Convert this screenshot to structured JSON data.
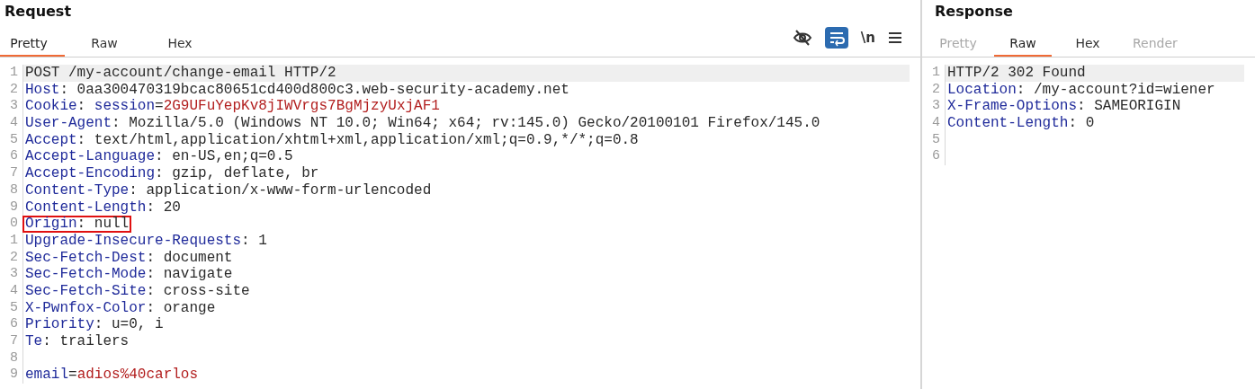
{
  "request": {
    "title": "Request",
    "tabs": [
      {
        "label": "Pretty",
        "selected": true,
        "disabled": false
      },
      {
        "label": "Raw",
        "selected": false,
        "disabled": false
      },
      {
        "label": "Hex",
        "selected": false,
        "disabled": false
      }
    ],
    "toolbar": [
      {
        "kind": "hide",
        "on": false
      },
      {
        "kind": "wrap",
        "on": true
      },
      {
        "kind": "newline",
        "label": "\\n",
        "on": false
      },
      {
        "kind": "menu"
      }
    ],
    "lines": [
      {
        "number": "1",
        "selected": true,
        "boxed": false,
        "parts": [
          {
            "kind": "plain",
            "text": "POST /my-account/change-email HTTP/2"
          }
        ]
      },
      {
        "number": "2",
        "selected": false,
        "boxed": false,
        "parts": [
          {
            "kind": "key",
            "text": "Host"
          },
          {
            "kind": "plain",
            "text": ": 0aa300470319bcac80651cd400d800c3.web-security-academy.net"
          }
        ]
      },
      {
        "number": "3",
        "selected": false,
        "boxed": false,
        "parts": [
          {
            "kind": "key",
            "text": "Cookie"
          },
          {
            "kind": "plain",
            "text": ": "
          },
          {
            "kind": "param",
            "text": "session"
          },
          {
            "kind": "plain",
            "text": "="
          },
          {
            "kind": "value",
            "text": "2G9UFuYepKv8jIWVrgs7BgMjzyUxjAF1"
          }
        ]
      },
      {
        "number": "4",
        "selected": false,
        "boxed": false,
        "parts": [
          {
            "kind": "key",
            "text": "User-Agent"
          },
          {
            "kind": "plain",
            "text": ": Mozilla/5.0 (Windows NT 10.0; Win64; x64; rv:145.0) Gecko/20100101 Firefox/145.0"
          }
        ]
      },
      {
        "number": "5",
        "selected": false,
        "boxed": false,
        "parts": [
          {
            "kind": "key",
            "text": "Accept"
          },
          {
            "kind": "plain",
            "text": ": text/html,application/xhtml+xml,application/xml;q=0.9,*/*;q=0.8"
          }
        ]
      },
      {
        "number": "6",
        "selected": false,
        "boxed": false,
        "parts": [
          {
            "kind": "key",
            "text": "Accept-Language"
          },
          {
            "kind": "plain",
            "text": ": en-US,en;q=0.5"
          }
        ]
      },
      {
        "number": "7",
        "selected": false,
        "boxed": false,
        "parts": [
          {
            "kind": "key",
            "text": "Accept-Encoding"
          },
          {
            "kind": "plain",
            "text": ": gzip, deflate, br"
          }
        ]
      },
      {
        "number": "8",
        "selected": false,
        "boxed": false,
        "parts": [
          {
            "kind": "key",
            "text": "Content-Type"
          },
          {
            "kind": "plain",
            "text": ": application/x-www-form-urlencoded"
          }
        ]
      },
      {
        "number": "9",
        "selected": false,
        "boxed": false,
        "parts": [
          {
            "kind": "key",
            "text": "Content-Length"
          },
          {
            "kind": "plain",
            "text": ": 20"
          }
        ]
      },
      {
        "number": "0",
        "selected": false,
        "boxed": true,
        "parts": [
          {
            "kind": "key",
            "text": "Origin"
          },
          {
            "kind": "plain",
            "text": ": null"
          }
        ]
      },
      {
        "number": "1",
        "selected": false,
        "boxed": false,
        "parts": [
          {
            "kind": "key",
            "text": "Upgrade-Insecure-Requests"
          },
          {
            "kind": "plain",
            "text": ": 1"
          }
        ]
      },
      {
        "number": "2",
        "selected": false,
        "boxed": false,
        "parts": [
          {
            "kind": "key",
            "text": "Sec-Fetch-Dest"
          },
          {
            "kind": "plain",
            "text": ": document"
          }
        ]
      },
      {
        "number": "3",
        "selected": false,
        "boxed": false,
        "parts": [
          {
            "kind": "key",
            "text": "Sec-Fetch-Mode"
          },
          {
            "kind": "plain",
            "text": ": navigate"
          }
        ]
      },
      {
        "number": "4",
        "selected": false,
        "boxed": false,
        "parts": [
          {
            "kind": "key",
            "text": "Sec-Fetch-Site"
          },
          {
            "kind": "plain",
            "text": ": cross-site"
          }
        ]
      },
      {
        "number": "5",
        "selected": false,
        "boxed": false,
        "parts": [
          {
            "kind": "key",
            "text": "X-Pwnfox-Color"
          },
          {
            "kind": "plain",
            "text": ": orange"
          }
        ]
      },
      {
        "number": "6",
        "selected": false,
        "boxed": false,
        "parts": [
          {
            "kind": "key",
            "text": "Priority"
          },
          {
            "kind": "plain",
            "text": ": u=0, i"
          }
        ]
      },
      {
        "number": "7",
        "selected": false,
        "boxed": false,
        "parts": [
          {
            "kind": "key",
            "text": "Te"
          },
          {
            "kind": "plain",
            "text": ": trailers"
          }
        ]
      },
      {
        "number": "8",
        "selected": false,
        "boxed": false
      },
      {
        "number": "9",
        "selected": false,
        "boxed": false,
        "parts": [
          {
            "kind": "param",
            "text": "email"
          },
          {
            "kind": "plain",
            "text": "="
          },
          {
            "kind": "value",
            "text": "adios%40carlos"
          }
        ]
      }
    ]
  },
  "response": {
    "title": "Response",
    "tabs": [
      {
        "label": "Pretty",
        "selected": false,
        "disabled": true
      },
      {
        "label": "Raw",
        "selected": true,
        "disabled": false
      },
      {
        "label": "Hex",
        "selected": false,
        "disabled": false
      },
      {
        "label": "Render",
        "selected": false,
        "disabled": true
      }
    ],
    "lines": [
      {
        "number": "1",
        "selected": true,
        "boxed": false,
        "parts": [
          {
            "kind": "plain",
            "text": "HTTP/2 302 Found"
          }
        ]
      },
      {
        "number": "2",
        "selected": false,
        "boxed": false,
        "parts": [
          {
            "kind": "key",
            "text": "Location"
          },
          {
            "kind": "plain",
            "text": ": /my-account?id=wiener"
          }
        ]
      },
      {
        "number": "3",
        "selected": false,
        "boxed": false,
        "parts": [
          {
            "kind": "key",
            "text": "X-Frame-Options"
          },
          {
            "kind": "plain",
            "text": ": SAMEORIGIN"
          }
        ]
      },
      {
        "number": "4",
        "selected": false,
        "boxed": false,
        "parts": [
          {
            "kind": "key",
            "text": "Content-Length"
          },
          {
            "kind": "plain",
            "text": ": 0"
          }
        ]
      },
      {
        "number": "5",
        "selected": false,
        "boxed": false
      },
      {
        "number": "6",
        "selected": false,
        "boxed": false
      }
    ]
  }
}
